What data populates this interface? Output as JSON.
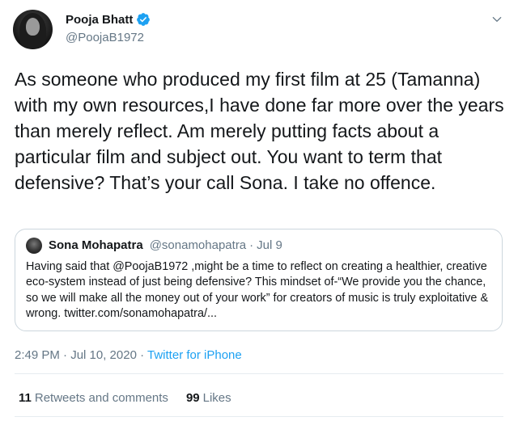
{
  "author": {
    "name": "Pooja Bhatt",
    "handle": "@PoojaB1972"
  },
  "tweet": {
    "text": "As someone who produced my first film at 25 (Tamanna) with my own resources,I have done far more over the years than merely reflect. Am merely putting facts about a particular film and subject out. You want to term that defensive? That’s your call Sona. I take no offence."
  },
  "quoted": {
    "name": "Sona Mohapatra",
    "handle": "@sonamohapatra",
    "separator": "·",
    "date": "Jul 9",
    "text": "Having said that @PoojaB1972 ,might be a time to reflect on creating a healthier, creative eco-system instead of  just being defensive? This mindset of-“We provide you the chance, so we will make all the money out of your work” for creators of music is truly exploitative & wrong. twitter.com/sonamohapatra/..."
  },
  "meta": {
    "timestamp": "2:49 PM · Jul 10, 2020",
    "separator": "·",
    "source": "Twitter for iPhone"
  },
  "stats": {
    "retweets_count": "11",
    "retweets_label": "Retweets and comments",
    "likes_count": "99",
    "likes_label": "Likes"
  },
  "icons": {
    "verified": "verified-badge-icon",
    "menu": "chevron-down-icon"
  },
  "colors": {
    "accent": "#1da1f2",
    "secondary_text": "#657786",
    "border": "#ccd6dd"
  }
}
